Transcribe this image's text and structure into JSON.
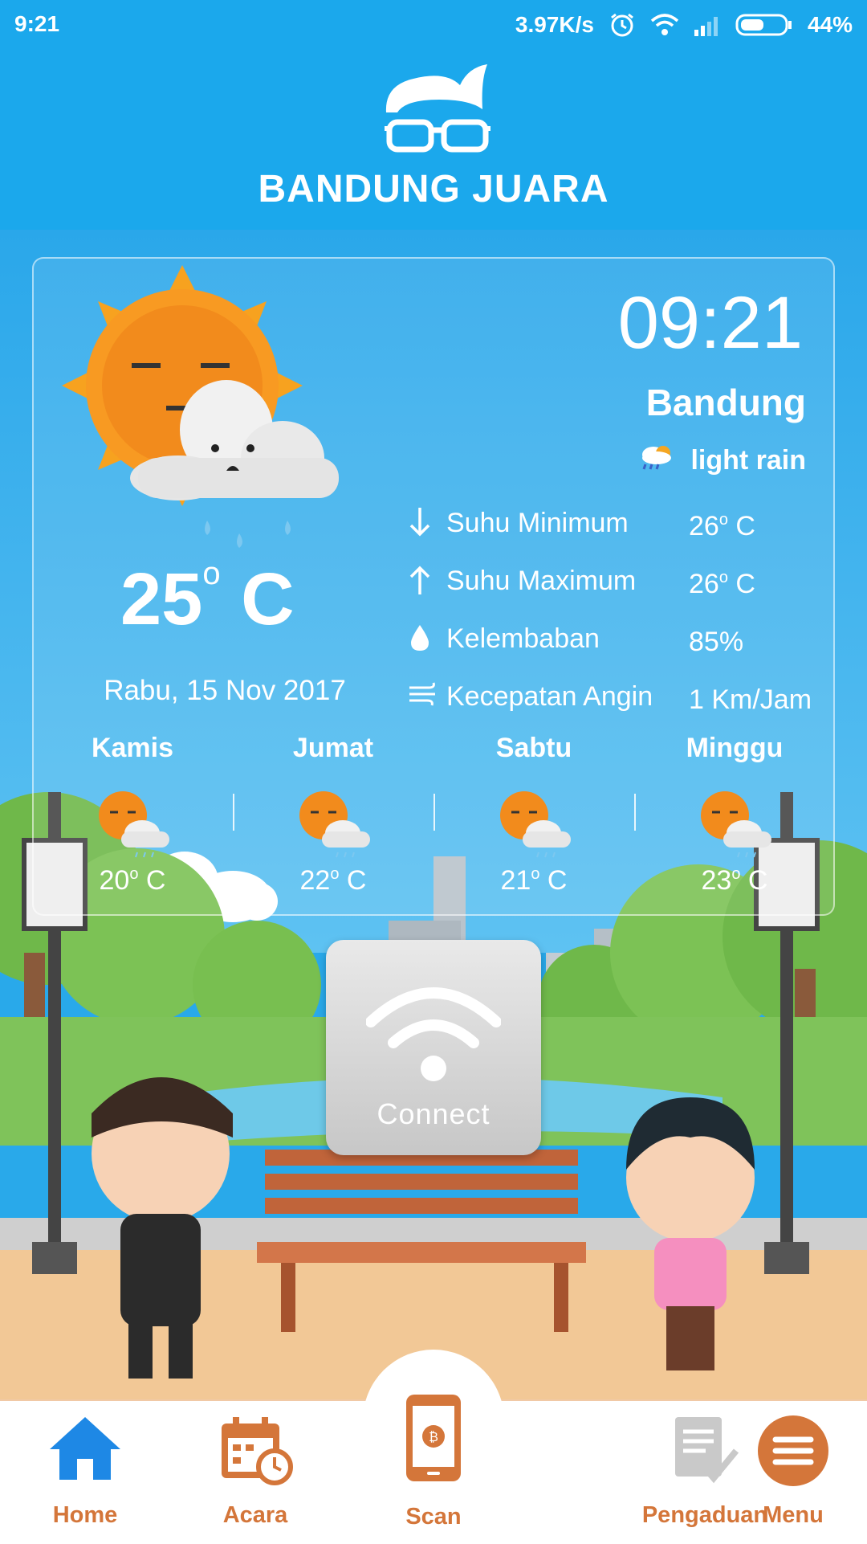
{
  "status_bar": {
    "time": "9:21",
    "speed": "3.97K/s",
    "battery": "44%",
    "battery_level": 0.44
  },
  "header": {
    "title": "BANDUNG JUARA"
  },
  "weather": {
    "temperature": "25",
    "degree": "o",
    "unit": "C",
    "date": "Rabu, 15 Nov 2017",
    "clock": "09:21",
    "city": "Bandung",
    "condition": "light rain",
    "stats": [
      {
        "icon": "arrow-down-icon",
        "label": "Suhu Minimum",
        "value": "26",
        "unit": " C"
      },
      {
        "icon": "arrow-up-icon",
        "label": "Suhu Maximum",
        "value": "26",
        "unit": " C"
      },
      {
        "icon": "water-drop-icon",
        "label": "Kelembaban",
        "value": "85%",
        "unit": ""
      },
      {
        "icon": "wind-icon",
        "label": "Kecepatan Angin",
        "value": "1 Km/Jam",
        "unit": ""
      }
    ]
  },
  "forecast": [
    {
      "day": "Kamis",
      "temp": "20",
      "unit": " C"
    },
    {
      "day": "Jumat",
      "temp": "22",
      "unit": " C"
    },
    {
      "day": "Sabtu",
      "temp": "21",
      "unit": " C"
    },
    {
      "day": "Minggu",
      "temp": "23",
      "unit": " C"
    }
  ],
  "connect": {
    "label": "Connect"
  },
  "nav": {
    "items": [
      {
        "label": "Home",
        "icon": "home-icon"
      },
      {
        "label": "Acara",
        "icon": "calendar-icon"
      },
      {
        "label": "Scan",
        "icon": "phone-scan-icon"
      },
      {
        "label": "Pengaduan",
        "icon": "document-check-icon"
      },
      {
        "label": "Menu",
        "icon": "menu-icon"
      }
    ]
  },
  "colors": {
    "header_blue": "#1ba8ec",
    "accent_orange": "#d4763a",
    "home_blue": "#1e88e5"
  }
}
